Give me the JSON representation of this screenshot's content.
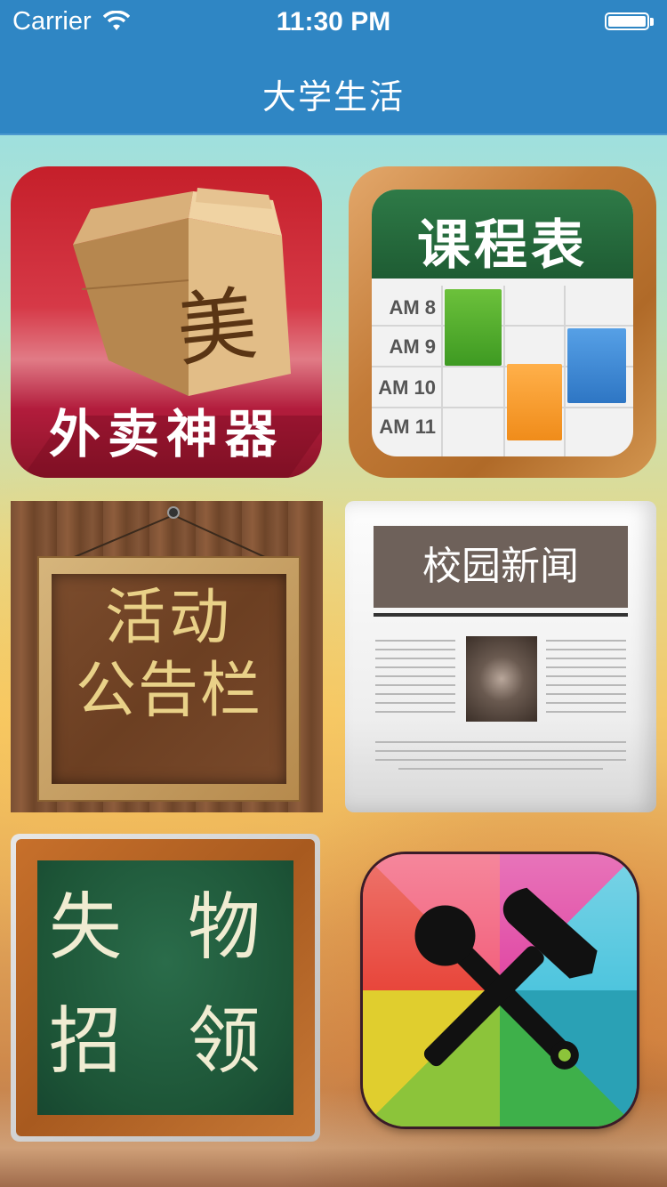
{
  "status_bar": {
    "carrier": "Carrier",
    "time": "11:30 PM",
    "wifi_icon": "wifi-icon",
    "battery_icon": "battery-icon",
    "battery_level": 1.0
  },
  "nav": {
    "title": "大学生活",
    "bar_color": "#2f86c4"
  },
  "tiles": [
    {
      "id": "takeout",
      "label": "外卖神器",
      "bag_glyph": "美",
      "icon": "paper-bag-icon"
    },
    {
      "id": "schedule",
      "title": "课程表",
      "hours": [
        "AM 8",
        "AM 9",
        "AM 10",
        "AM 11"
      ],
      "icon": "calendar-icon"
    },
    {
      "id": "bulletin",
      "line1": "活动",
      "line2": "公告栏",
      "icon": "notice-board-icon"
    },
    {
      "id": "news",
      "banner": "校园新闻",
      "icon": "newspaper-icon"
    },
    {
      "id": "lost_found",
      "line1": "失 物",
      "line2": "招 领",
      "icon": "chalkboard-icon"
    },
    {
      "id": "tools",
      "icon": "hammer-wrench-icon"
    }
  ]
}
